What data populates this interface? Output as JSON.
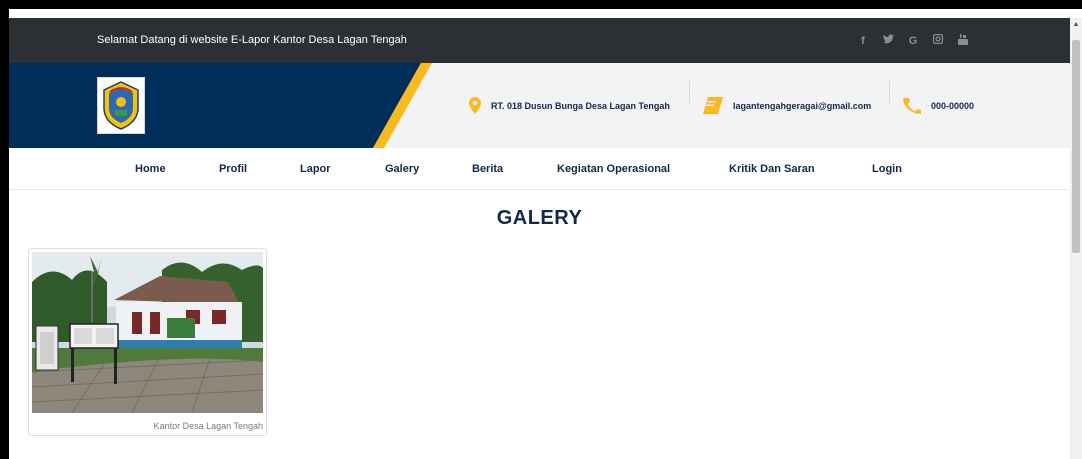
{
  "topbar": {
    "welcome": "Selamat Datang di website E-Lapor Kantor Desa Lagan Tengah",
    "socials": [
      {
        "icon": "facebook-icon",
        "glyph": "f"
      },
      {
        "icon": "twitter-icon",
        "glyph": "🐦"
      },
      {
        "icon": "google-icon",
        "glyph": "G"
      },
      {
        "icon": "instagram-icon",
        "glyph": "◙"
      },
      {
        "icon": "youtube-icon",
        "glyph": "▣"
      }
    ]
  },
  "header": {
    "address": "RT. 018 Dusun Bunga Desa Lagan Tengah",
    "email": "lagantengahgeragai@gmail.com",
    "phone": "000-00000",
    "colors": {
      "navy": "#002e5b",
      "accent": "#fdb81e",
      "topbar": "#2c3035"
    }
  },
  "nav": {
    "items": [
      "Home",
      "Profil",
      "Lapor",
      "Galery",
      "Berita",
      "Kegiatan Operasional",
      "Kritik Dan Saran",
      "Login"
    ]
  },
  "main": {
    "title": "GALERY",
    "gallery": [
      {
        "caption": "Kantor Desa Lagan Tengah"
      }
    ]
  }
}
